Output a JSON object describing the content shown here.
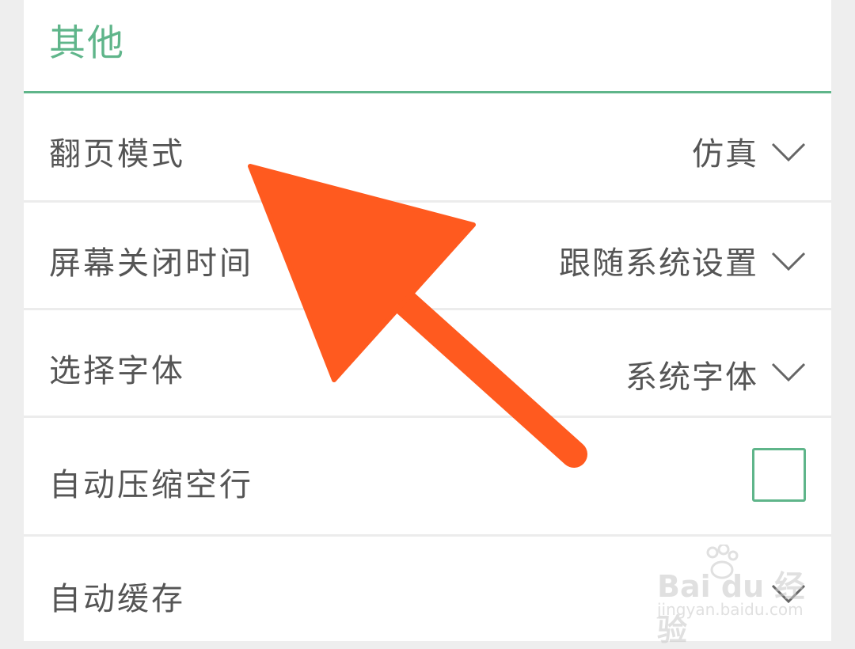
{
  "section": {
    "title": "其他"
  },
  "rows": [
    {
      "label": "翻页模式",
      "value": "仿真",
      "control": "dropdown"
    },
    {
      "label": "屏幕关闭时间",
      "value": "跟随系统设置",
      "control": "dropdown"
    },
    {
      "label": "选择字体",
      "value": "系统字体",
      "control": "dropdown"
    },
    {
      "label": "自动压缩空行",
      "checked": false,
      "control": "checkbox"
    },
    {
      "label": "自动缓存",
      "value": "",
      "control": "dropdown"
    }
  ],
  "watermark": {
    "main": "Bai du 经验",
    "sub": "jingyan.baidu.com"
  },
  "colors": {
    "accent": "#5fb58a",
    "annotation_arrow": "#ff5a1f",
    "text": "#555555",
    "divider": "#ececec"
  },
  "icons": {
    "dropdown": "chevron-down-icon",
    "annotation": "arrow-pointer-icon"
  }
}
